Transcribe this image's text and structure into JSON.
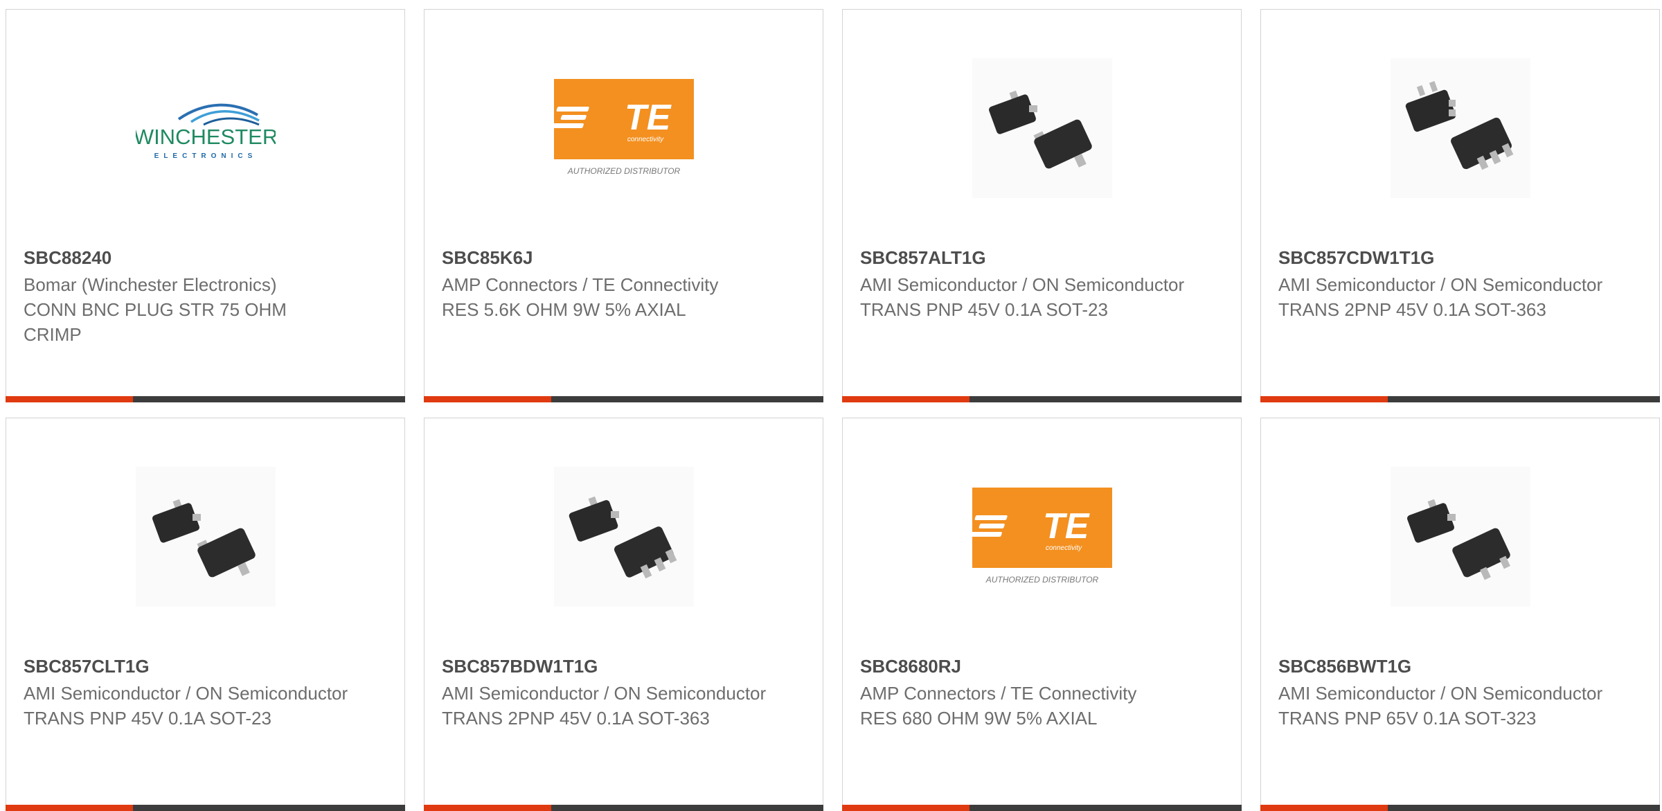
{
  "colors": {
    "accent": "#e03a10",
    "bar_dark": "#3c3c3c",
    "part_number": "#4d4d4d",
    "text": "#6d6d6d",
    "te_orange": "#f39020"
  },
  "products": [
    {
      "part_number": "SBC88240",
      "manufacturer": "Bomar (Winchester Electronics)",
      "description": "CONN BNC PLUG STR 75 OHM CRIMP",
      "image": "winchester-logo",
      "logo": {
        "name": "WINCHESTER",
        "sub": "ELECTRONICS"
      }
    },
    {
      "part_number": "SBC85K6J",
      "manufacturer": "AMP Connectors / TE Connectivity",
      "description": "RES 5.6K OHM 9W 5% AXIAL",
      "image": "te-logo",
      "logo": {
        "name": "TE",
        "sub": "connectivity",
        "caption": "AUTHORIZED DISTRIBUTOR"
      }
    },
    {
      "part_number": "SBC857ALT1G",
      "manufacturer": "AMI Semiconductor / ON Semiconductor",
      "description": "TRANS PNP 45V 0.1A SOT-23",
      "image": "sot23-package-icon"
    },
    {
      "part_number": "SBC857CDW1T1G",
      "manufacturer": "AMI Semiconductor / ON Semiconductor",
      "description": "TRANS 2PNP 45V 0.1A SOT-363",
      "image": "sot363-package-icon"
    },
    {
      "part_number": "SBC857CLT1G",
      "manufacturer": "AMI Semiconductor / ON Semiconductor",
      "description": "TRANS PNP 45V 0.1A SOT-23",
      "image": "sot23-package-icon"
    },
    {
      "part_number": "SBC857BDW1T1G",
      "manufacturer": "AMI Semiconductor / ON Semiconductor",
      "description": "TRANS 2PNP 45V 0.1A SOT-363",
      "image": "sot363-package-icon"
    },
    {
      "part_number": "SBC8680RJ",
      "manufacturer": "AMP Connectors / TE Connectivity",
      "description": "RES 680 OHM 9W 5% AXIAL",
      "image": "te-logo",
      "logo": {
        "name": "TE",
        "sub": "connectivity",
        "caption": "AUTHORIZED DISTRIBUTOR"
      }
    },
    {
      "part_number": "SBC856BWT1G",
      "manufacturer": "AMI Semiconductor / ON Semiconductor",
      "description": "TRANS PNP 65V 0.1A SOT-323",
      "image": "sot23-package-icon"
    }
  ]
}
